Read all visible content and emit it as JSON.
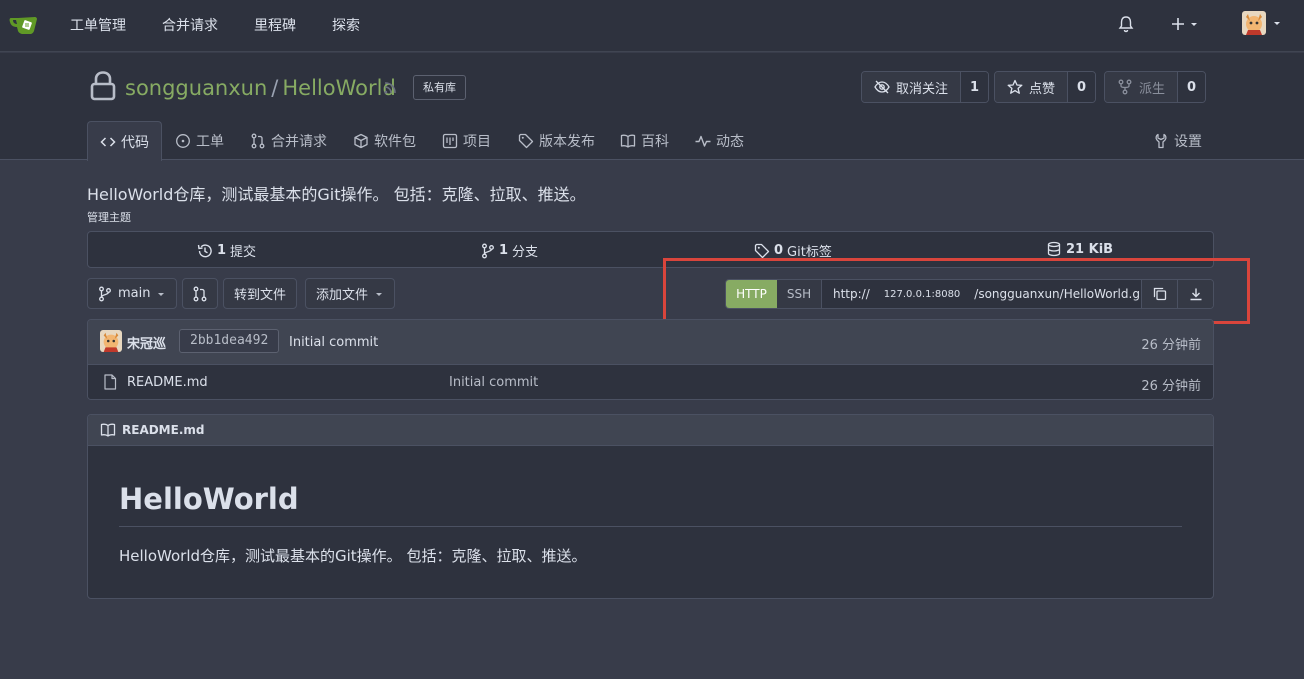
{
  "nav": {
    "items": [
      "工单管理",
      "合并请求",
      "里程碑",
      "探索"
    ]
  },
  "repo": {
    "owner": "songguanxun",
    "separator": "/",
    "name": "HelloWorld",
    "private_badge": "私有库",
    "unwatch_label": "取消关注",
    "watch_count": "1",
    "star_label": "点赞",
    "star_count": "0",
    "fork_label": "派生",
    "fork_count": "0",
    "description": "HelloWorld仓库，测试最基本的Git操作。 包括：克隆、拉取、推送。",
    "topics_label": "管理主题"
  },
  "tabs": [
    {
      "label": "代码",
      "icon": "code-icon"
    },
    {
      "label": "工单",
      "icon": "issue-icon"
    },
    {
      "label": "合并请求",
      "icon": "pull-request-icon"
    },
    {
      "label": "软件包",
      "icon": "package-icon"
    },
    {
      "label": "项目",
      "icon": "project-icon"
    },
    {
      "label": "版本发布",
      "icon": "tag-icon"
    },
    {
      "label": "百科",
      "icon": "book-icon"
    },
    {
      "label": "动态",
      "icon": "pulse-icon"
    }
  ],
  "settings_label": "设置",
  "stats": {
    "commits_count": "1",
    "commits_label": "提交",
    "branches_count": "1",
    "branches_label": "分支",
    "tags_count": "0",
    "tags_label": "Git标签",
    "size": "21 KiB"
  },
  "branch": {
    "name": "main",
    "goto_file": "转到文件",
    "add_file": "添加文件"
  },
  "clone": {
    "http": "HTTP",
    "ssh": "SSH",
    "url_prefix": "http://",
    "url_host": "127.0.0.1:8080",
    "url_path": "/songguanxun/HelloWorld.git"
  },
  "latest_commit": {
    "author": "宋冠巡",
    "sha": "2bb1dea492",
    "message": "Initial commit",
    "time": "26 分钟前"
  },
  "files": [
    {
      "name": "README.md",
      "commit": "Initial commit",
      "time": "26 分钟前"
    }
  ],
  "readme": {
    "filename": "README.md",
    "heading": "HelloWorld",
    "body": "HelloWorld仓库，测试最基本的Git操作。 包括：克隆、拉取、推送。"
  },
  "colors": {
    "accent": "#87ab63",
    "highlight": "#d9453c"
  }
}
